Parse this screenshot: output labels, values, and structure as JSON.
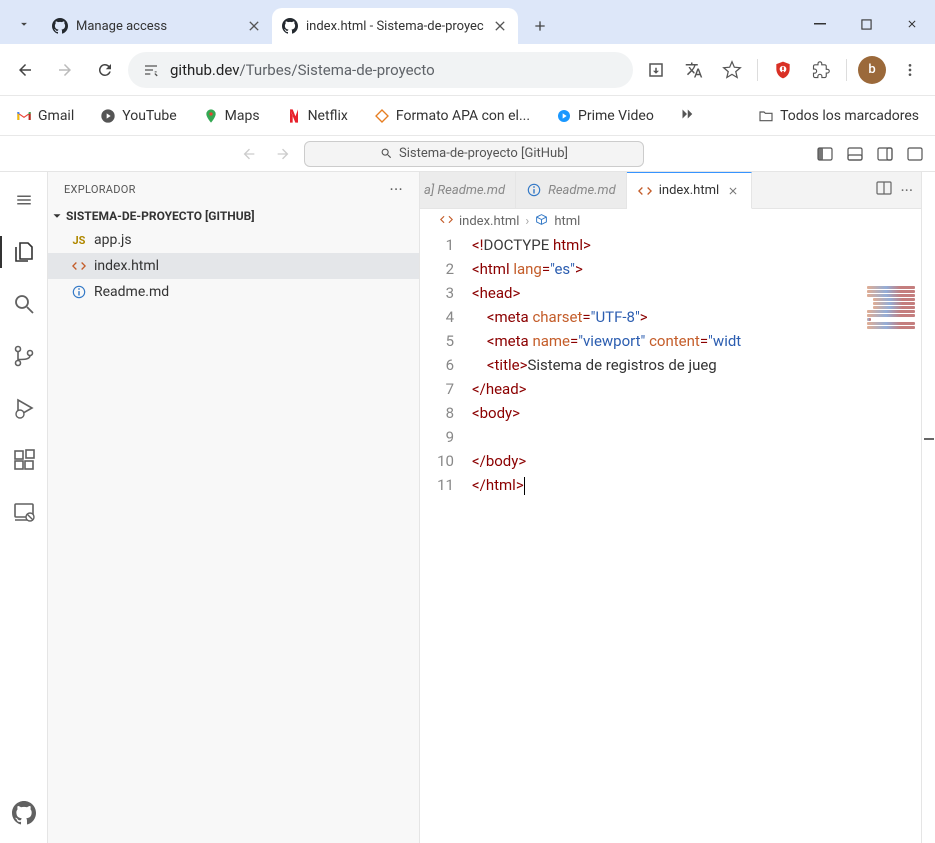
{
  "browser": {
    "tabs": [
      {
        "title": "Manage access"
      },
      {
        "title": "index.html - Sistema-de-proyec"
      }
    ],
    "url_host": "github.dev",
    "url_path": "/Turbes/Sistema-de-proyecto",
    "profile_letter": "b"
  },
  "bookmarks": {
    "items": [
      "Gmail",
      "YouTube",
      "Maps",
      "Netflix",
      "Formato APA con el...",
      "Prime Video"
    ],
    "all": "Todos los marcadores"
  },
  "vscode": {
    "command_center": "Sistema-de-proyecto [GitHub]",
    "explorer_title": "EXPLORADOR",
    "project_name": "SISTEMA-DE-PROYECTO [GITHUB]",
    "files": [
      {
        "name": "app.js",
        "type": "js"
      },
      {
        "name": "index.html",
        "type": "html"
      },
      {
        "name": "Readme.md",
        "type": "info"
      }
    ],
    "selected_file_index": 1,
    "tabs": [
      {
        "label": "a] Readme.md",
        "icon": "info",
        "style": "italic-partial"
      },
      {
        "label": "Readme.md",
        "icon": "info",
        "style": "italic"
      },
      {
        "label": "index.html",
        "icon": "html",
        "style": "active"
      }
    ],
    "breadcrumb": {
      "file": "index.html",
      "symbol": "html"
    },
    "code": {
      "lines": [
        {
          "n": 1,
          "segs": [
            [
              "angle",
              "<!"
            ],
            [
              "doctype",
              "DOCTYPE"
            ],
            [
              "text",
              " "
            ],
            [
              "tag",
              "html"
            ],
            [
              "angle",
              ">"
            ]
          ]
        },
        {
          "n": 2,
          "segs": [
            [
              "angle",
              "<"
            ],
            [
              "tag",
              "html"
            ],
            [
              "text",
              " "
            ],
            [
              "attr",
              "lang"
            ],
            [
              "angle",
              "="
            ],
            [
              "str",
              "\"es\""
            ],
            [
              "angle",
              ">"
            ]
          ]
        },
        {
          "n": 3,
          "segs": [
            [
              "angle",
              "<"
            ],
            [
              "tag",
              "head"
            ],
            [
              "angle",
              ">"
            ]
          ]
        },
        {
          "n": 4,
          "indent": 1,
          "segs": [
            [
              "angle",
              "<"
            ],
            [
              "tag",
              "meta"
            ],
            [
              "text",
              " "
            ],
            [
              "attr",
              "charset"
            ],
            [
              "angle",
              "="
            ],
            [
              "str",
              "\"UTF-8\""
            ],
            [
              "angle",
              ">"
            ]
          ]
        },
        {
          "n": 5,
          "indent": 1,
          "segs": [
            [
              "angle",
              "<"
            ],
            [
              "tag",
              "meta"
            ],
            [
              "text",
              " "
            ],
            [
              "attr",
              "name"
            ],
            [
              "angle",
              "="
            ],
            [
              "str",
              "\"viewport\""
            ],
            [
              "text",
              " "
            ],
            [
              "attr",
              "content"
            ],
            [
              "angle",
              "="
            ],
            [
              "str",
              "\"widt"
            ]
          ]
        },
        {
          "n": 6,
          "indent": 1,
          "segs": [
            [
              "angle",
              "<"
            ],
            [
              "tag",
              "title"
            ],
            [
              "angle",
              ">"
            ],
            [
              "text",
              "Sistema de registros de jueg"
            ]
          ]
        },
        {
          "n": 7,
          "segs": [
            [
              "angle",
              "</"
            ],
            [
              "tag",
              "head"
            ],
            [
              "angle",
              ">"
            ]
          ]
        },
        {
          "n": 8,
          "segs": [
            [
              "angle",
              "<"
            ],
            [
              "tag",
              "body"
            ],
            [
              "angle",
              ">"
            ]
          ]
        },
        {
          "n": 9,
          "segs": []
        },
        {
          "n": 10,
          "segs": [
            [
              "angle",
              "</"
            ],
            [
              "tag",
              "body"
            ],
            [
              "angle",
              ">"
            ]
          ]
        },
        {
          "n": 11,
          "segs": [
            [
              "angle",
              "</"
            ],
            [
              "tag",
              "html"
            ],
            [
              "angle",
              ">"
            ]
          ],
          "cursor": true
        }
      ]
    }
  }
}
